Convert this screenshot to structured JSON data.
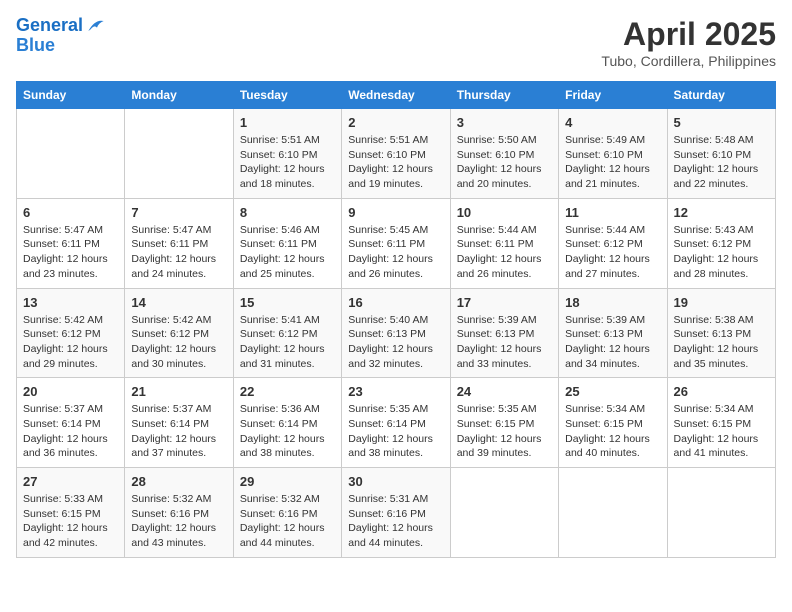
{
  "header": {
    "logo_line1": "General",
    "logo_line2": "Blue",
    "title": "April 2025",
    "subtitle": "Tubo, Cordillera, Philippines"
  },
  "days_of_week": [
    "Sunday",
    "Monday",
    "Tuesday",
    "Wednesday",
    "Thursday",
    "Friday",
    "Saturday"
  ],
  "weeks": [
    [
      {
        "day": "",
        "info": ""
      },
      {
        "day": "",
        "info": ""
      },
      {
        "day": "1",
        "info": "Sunrise: 5:51 AM\nSunset: 6:10 PM\nDaylight: 12 hours and 18 minutes."
      },
      {
        "day": "2",
        "info": "Sunrise: 5:51 AM\nSunset: 6:10 PM\nDaylight: 12 hours and 19 minutes."
      },
      {
        "day": "3",
        "info": "Sunrise: 5:50 AM\nSunset: 6:10 PM\nDaylight: 12 hours and 20 minutes."
      },
      {
        "day": "4",
        "info": "Sunrise: 5:49 AM\nSunset: 6:10 PM\nDaylight: 12 hours and 21 minutes."
      },
      {
        "day": "5",
        "info": "Sunrise: 5:48 AM\nSunset: 6:10 PM\nDaylight: 12 hours and 22 minutes."
      }
    ],
    [
      {
        "day": "6",
        "info": "Sunrise: 5:47 AM\nSunset: 6:11 PM\nDaylight: 12 hours and 23 minutes."
      },
      {
        "day": "7",
        "info": "Sunrise: 5:47 AM\nSunset: 6:11 PM\nDaylight: 12 hours and 24 minutes."
      },
      {
        "day": "8",
        "info": "Sunrise: 5:46 AM\nSunset: 6:11 PM\nDaylight: 12 hours and 25 minutes."
      },
      {
        "day": "9",
        "info": "Sunrise: 5:45 AM\nSunset: 6:11 PM\nDaylight: 12 hours and 26 minutes."
      },
      {
        "day": "10",
        "info": "Sunrise: 5:44 AM\nSunset: 6:11 PM\nDaylight: 12 hours and 26 minutes."
      },
      {
        "day": "11",
        "info": "Sunrise: 5:44 AM\nSunset: 6:12 PM\nDaylight: 12 hours and 27 minutes."
      },
      {
        "day": "12",
        "info": "Sunrise: 5:43 AM\nSunset: 6:12 PM\nDaylight: 12 hours and 28 minutes."
      }
    ],
    [
      {
        "day": "13",
        "info": "Sunrise: 5:42 AM\nSunset: 6:12 PM\nDaylight: 12 hours and 29 minutes."
      },
      {
        "day": "14",
        "info": "Sunrise: 5:42 AM\nSunset: 6:12 PM\nDaylight: 12 hours and 30 minutes."
      },
      {
        "day": "15",
        "info": "Sunrise: 5:41 AM\nSunset: 6:12 PM\nDaylight: 12 hours and 31 minutes."
      },
      {
        "day": "16",
        "info": "Sunrise: 5:40 AM\nSunset: 6:13 PM\nDaylight: 12 hours and 32 minutes."
      },
      {
        "day": "17",
        "info": "Sunrise: 5:39 AM\nSunset: 6:13 PM\nDaylight: 12 hours and 33 minutes."
      },
      {
        "day": "18",
        "info": "Sunrise: 5:39 AM\nSunset: 6:13 PM\nDaylight: 12 hours and 34 minutes."
      },
      {
        "day": "19",
        "info": "Sunrise: 5:38 AM\nSunset: 6:13 PM\nDaylight: 12 hours and 35 minutes."
      }
    ],
    [
      {
        "day": "20",
        "info": "Sunrise: 5:37 AM\nSunset: 6:14 PM\nDaylight: 12 hours and 36 minutes."
      },
      {
        "day": "21",
        "info": "Sunrise: 5:37 AM\nSunset: 6:14 PM\nDaylight: 12 hours and 37 minutes."
      },
      {
        "day": "22",
        "info": "Sunrise: 5:36 AM\nSunset: 6:14 PM\nDaylight: 12 hours and 38 minutes."
      },
      {
        "day": "23",
        "info": "Sunrise: 5:35 AM\nSunset: 6:14 PM\nDaylight: 12 hours and 38 minutes."
      },
      {
        "day": "24",
        "info": "Sunrise: 5:35 AM\nSunset: 6:15 PM\nDaylight: 12 hours and 39 minutes."
      },
      {
        "day": "25",
        "info": "Sunrise: 5:34 AM\nSunset: 6:15 PM\nDaylight: 12 hours and 40 minutes."
      },
      {
        "day": "26",
        "info": "Sunrise: 5:34 AM\nSunset: 6:15 PM\nDaylight: 12 hours and 41 minutes."
      }
    ],
    [
      {
        "day": "27",
        "info": "Sunrise: 5:33 AM\nSunset: 6:15 PM\nDaylight: 12 hours and 42 minutes."
      },
      {
        "day": "28",
        "info": "Sunrise: 5:32 AM\nSunset: 6:16 PM\nDaylight: 12 hours and 43 minutes."
      },
      {
        "day": "29",
        "info": "Sunrise: 5:32 AM\nSunset: 6:16 PM\nDaylight: 12 hours and 44 minutes."
      },
      {
        "day": "30",
        "info": "Sunrise: 5:31 AM\nSunset: 6:16 PM\nDaylight: 12 hours and 44 minutes."
      },
      {
        "day": "",
        "info": ""
      },
      {
        "day": "",
        "info": ""
      },
      {
        "day": "",
        "info": ""
      }
    ]
  ]
}
